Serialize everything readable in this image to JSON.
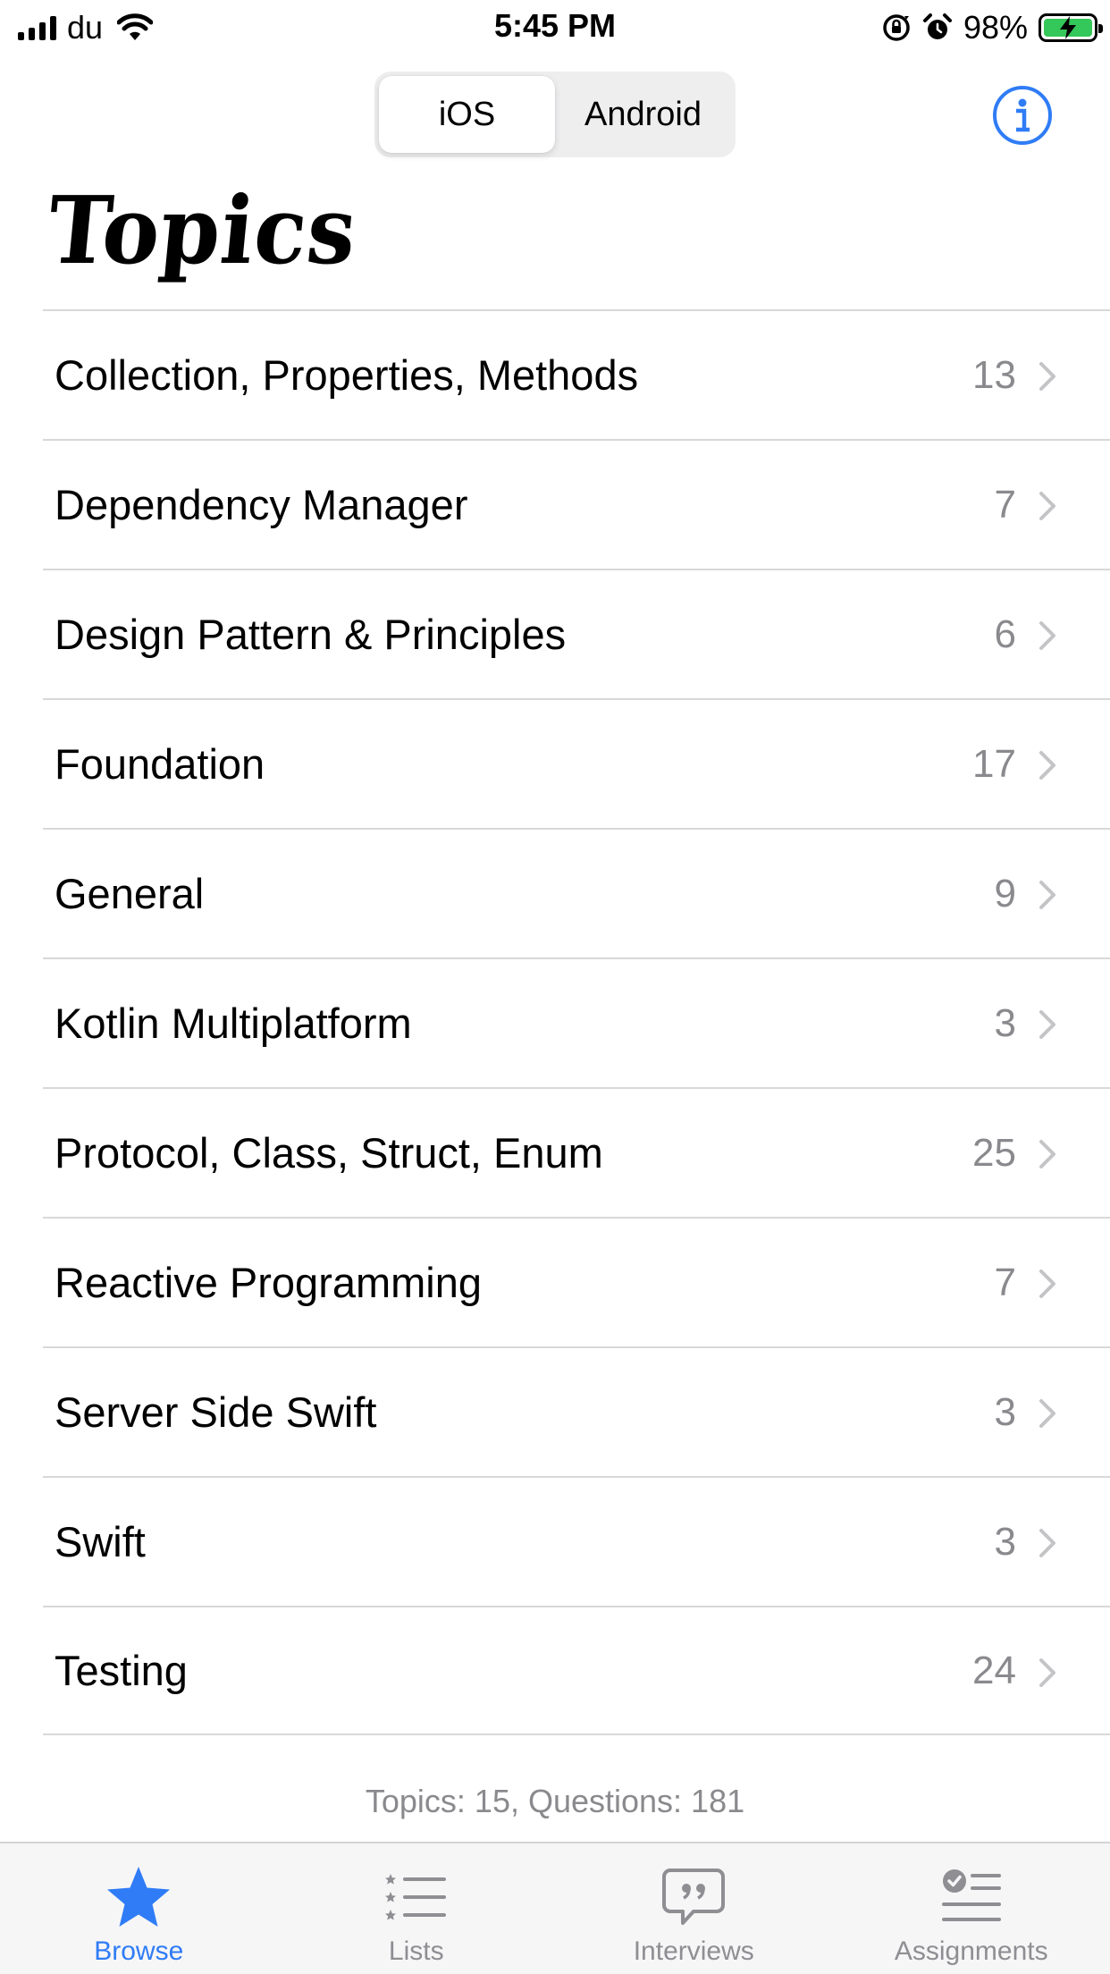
{
  "status_bar": {
    "carrier": "du",
    "time": "5:45 PM",
    "battery": "98%"
  },
  "segmented": {
    "options": [
      "iOS",
      "Android"
    ],
    "selected": "iOS"
  },
  "header": {
    "title": "Topics"
  },
  "topics": [
    {
      "label": "Collection, Properties, Methods",
      "count": "13"
    },
    {
      "label": "Dependency Manager",
      "count": "7"
    },
    {
      "label": "Design Pattern & Principles",
      "count": "6"
    },
    {
      "label": "Foundation",
      "count": "17"
    },
    {
      "label": "General",
      "count": "9"
    },
    {
      "label": "Kotlin Multiplatform",
      "count": "3"
    },
    {
      "label": "Protocol, Class, Struct, Enum",
      "count": "25"
    },
    {
      "label": "Reactive Programming",
      "count": "7"
    },
    {
      "label": "Server Side Swift",
      "count": "3"
    },
    {
      "label": "Swift",
      "count": "3"
    },
    {
      "label": "Testing",
      "count": "24"
    }
  ],
  "summary": "Topics: 15, Questions: 181",
  "tabs": [
    {
      "label": "Browse",
      "icon": "star-icon",
      "active": true
    },
    {
      "label": "Lists",
      "icon": "list-icon",
      "active": false
    },
    {
      "label": "Interviews",
      "icon": "quote-bubble-icon",
      "active": false
    },
    {
      "label": "Assignments",
      "icon": "checklist-icon",
      "active": false
    }
  ],
  "colors": {
    "accent": "#2f7cf6",
    "battery": "#34c759",
    "secondary_text": "#8a8a8e",
    "separator": "#d8d8da"
  }
}
